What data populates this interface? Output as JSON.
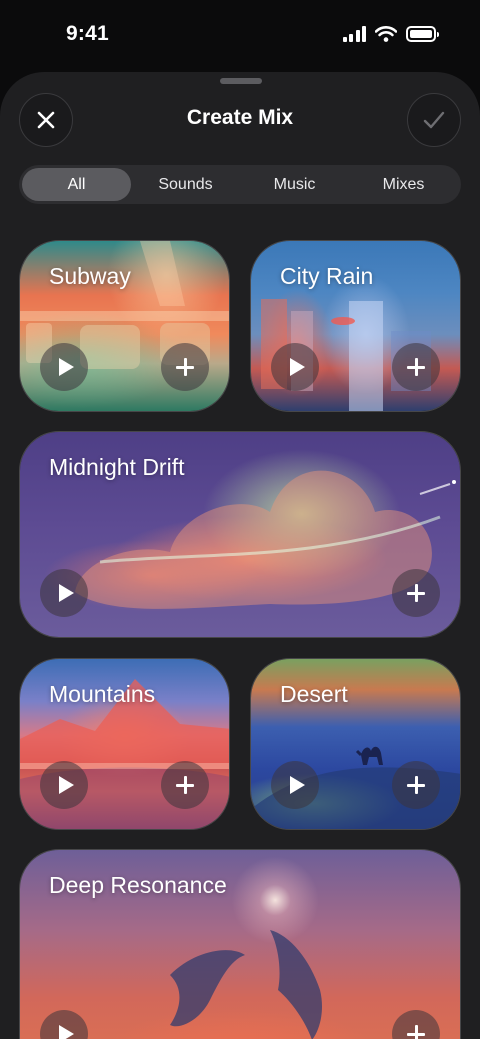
{
  "status_bar": {
    "time": "9:41"
  },
  "header": {
    "title": "Create Mix",
    "close_icon": "close-icon",
    "confirm_icon": "checkmark-icon"
  },
  "tabs": [
    {
      "label": "All",
      "active": true
    },
    {
      "label": "Sounds",
      "active": false
    },
    {
      "label": "Music",
      "active": false
    },
    {
      "label": "Mixes",
      "active": false
    }
  ],
  "cards": [
    {
      "title": "Subway"
    },
    {
      "title": "City Rain"
    },
    {
      "title": "Midnight Drift"
    },
    {
      "title": "Mountains"
    },
    {
      "title": "Desert"
    },
    {
      "title": "Deep Resonance"
    }
  ],
  "colors": {
    "sheet_background": "#1f1f21",
    "segment_background": "#2d2d30",
    "segment_active": "#5b5b5f"
  }
}
